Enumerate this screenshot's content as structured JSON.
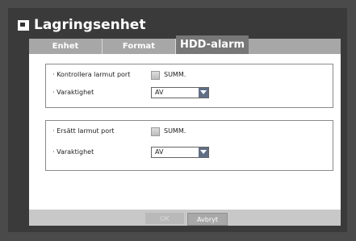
{
  "window": {
    "title": "Lagringsenhet",
    "title_icon": "storage-icon"
  },
  "tabs": [
    {
      "label": "Enhet",
      "active": false
    },
    {
      "label": "Format",
      "active": false
    },
    {
      "label": "HDD-alarm",
      "active": true
    }
  ],
  "panels": [
    {
      "port_label": "· Kontrollera larmut port",
      "port_checkbox_label": "SUMM.",
      "port_checked": false,
      "duration_label": "· Varaktighet",
      "duration_value": "AV"
    },
    {
      "port_label": "· Ersätt larmut port",
      "port_checkbox_label": "SUMM.",
      "port_checked": false,
      "duration_label": "· Varaktighet",
      "duration_value": "AV"
    }
  ],
  "footer": {
    "ok_label": "OK",
    "ok_enabled": false,
    "cancel_label": "Avbryt"
  },
  "colors": {
    "accent": "#5f6f86",
    "active_tab": "#777777",
    "inactive_tab": "#a7a7a7"
  }
}
